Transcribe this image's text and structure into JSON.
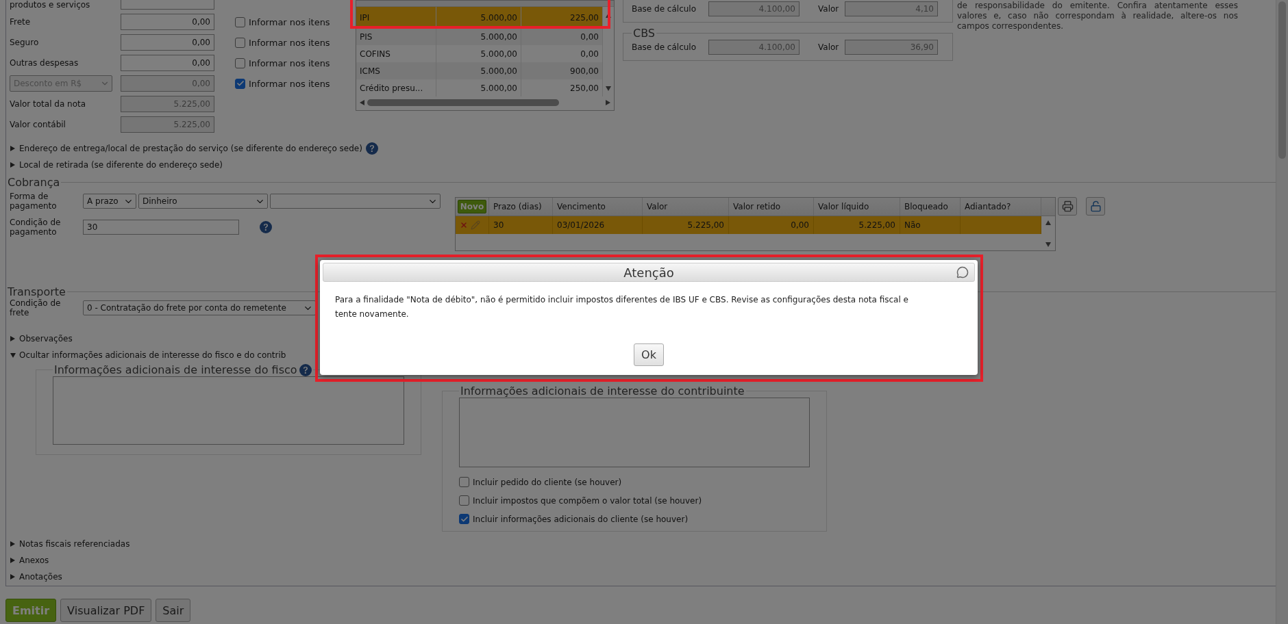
{
  "summary": {
    "rows": [
      {
        "kind": "input",
        "label": "produtos e serviços"
      },
      {
        "kind": "input",
        "label": "Frete",
        "value": "0,00",
        "disabled": false,
        "inform": {
          "label": "Informar nos itens",
          "checked": false
        }
      },
      {
        "kind": "input",
        "label": "Seguro",
        "value": "0,00",
        "disabled": false,
        "inform": {
          "label": "Informar nos itens",
          "checked": false
        }
      },
      {
        "kind": "input",
        "label": "Outras despesas",
        "value": "0,00",
        "disabled": false,
        "inform": {
          "label": "Informar nos itens",
          "checked": false
        }
      },
      {
        "kind": "select",
        "label": "Desconto em R$",
        "value": "0,00",
        "disabled": true,
        "inform": {
          "label": "Informar nos itens",
          "checked": true
        }
      },
      {
        "kind": "input",
        "label": "Valor total da nota",
        "value": "5.225,00",
        "disabled": true
      },
      {
        "kind": "input",
        "label": "Valor contábil",
        "value": "5.225,00",
        "disabled": true
      }
    ]
  },
  "taxes": {
    "rows": [
      {
        "name": "IPI",
        "base": "5.000,00",
        "value": "225,00",
        "selected": true
      },
      {
        "name": "PIS",
        "base": "5.000,00",
        "value": "0,00",
        "selected": false
      },
      {
        "name": "COFINS",
        "base": "5.000,00",
        "value": "0,00",
        "selected": false
      },
      {
        "name": "ICMS",
        "base": "5.000,00",
        "value": "900,00",
        "selected": false
      },
      {
        "name": "Crédito presu...",
        "base": "5.000,00",
        "value": "250,00",
        "selected": false
      }
    ]
  },
  "ibs_cbs": [
    {
      "fields": [
        {
          "label": "Base de cálculo",
          "value": "4.100,00"
        },
        {
          "label": "Valor",
          "value": "4,10"
        }
      ]
    },
    {
      "legend": "CBS",
      "fields": [
        {
          "label": "Base de cálculo",
          "value": "4.100,00"
        },
        {
          "label": "Valor",
          "value": "36,90"
        }
      ]
    }
  ],
  "notice": "de responsabilidade do emitente. Confira atentamente esses valores e, caso não correspondam à realidade, altere-os nos campos correspondentes.",
  "sections_top": [
    {
      "label": "Endereço de entrega/local de prestação do serviço (se diferente do endereço sede)",
      "expanded": false,
      "help": true
    },
    {
      "label": "Local de retirada (se diferente do endereço sede)",
      "expanded": false
    }
  ],
  "cobranca": {
    "title": "Cobrança",
    "payment_form": {
      "label": "Forma de pagamento",
      "selects": [
        {
          "kind": "select",
          "value": "A prazo"
        },
        {
          "kind": "select",
          "value": "Dinheiro"
        },
        {
          "kind": "select"
        }
      ]
    },
    "condition": {
      "label": "Condição de pagamento",
      "value": "30",
      "help": true
    },
    "installments": {
      "new_button": "Novo",
      "columns": [
        "Prazo (dias)",
        "Vencimento",
        "Valor",
        "Valor retido",
        "Valor líquido",
        "Bloqueado",
        "Adiantado?"
      ],
      "rows": [
        {
          "cells": [
            "30",
            "03/01/2026",
            "5.225,00",
            "0,00",
            "5.225,00",
            "Não"
          ],
          "selected": true
        }
      ]
    }
  },
  "transporte": {
    "title": "Transporte",
    "freight": {
      "label": "Condição de frete",
      "value": "0 - Contratação do frete por conta do remetente"
    }
  },
  "sections_mid": [
    {
      "label": "Observações",
      "expanded": false
    },
    {
      "label": "Ocultar informações adicionais de interesse do fisco e do contrib",
      "expanded": true
    }
  ],
  "additional": [
    {
      "legend": "Informações adicionais de interesse do fisco",
      "help": true
    },
    {
      "legend": "Informações adicionais de interesse do contribuinte",
      "options": [
        {
          "label": "Incluir pedido do cliente (se houver)",
          "checked": false
        },
        {
          "label": "Incluir impostos que compõem o valor total (se houver)",
          "checked": false
        },
        {
          "label": "Incluir informações adicionais do cliente (se houver)",
          "checked": true
        }
      ]
    }
  ],
  "sections_bottom": [
    {
      "label": "Notas fiscais referenciadas",
      "expanded": false
    },
    {
      "label": "Anexos",
      "expanded": false
    },
    {
      "label": "Anotações",
      "expanded": false
    }
  ],
  "actions": [
    {
      "label": "Emitir",
      "kind": "primary"
    },
    {
      "label": "Visualizar PDF",
      "kind": "default"
    },
    {
      "label": "Sair",
      "kind": "default"
    }
  ],
  "dialog": {
    "title": "Atenção",
    "message": "Para a finalidade \"Nota de débito\", não é permitido incluir impostos diferentes de IBS UF e CBS. Revise as configurações desta nota fiscal e tente novamente.",
    "button": "Ok"
  }
}
